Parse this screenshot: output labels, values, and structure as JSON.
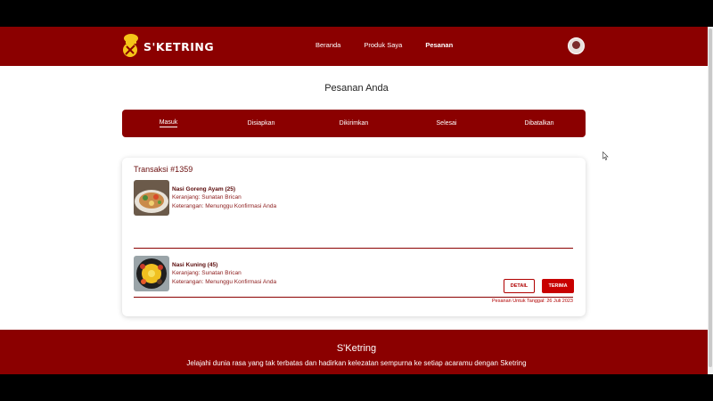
{
  "brand": {
    "name": "S'KETRING"
  },
  "nav": {
    "links": [
      {
        "label": "Beranda"
      },
      {
        "label": "Produk Saya"
      },
      {
        "label": "Pesanan"
      }
    ]
  },
  "page": {
    "title": "Pesanan Anda"
  },
  "tabs": [
    {
      "label": "Masuk"
    },
    {
      "label": "Disiapkan"
    },
    {
      "label": "Dikirimkan"
    },
    {
      "label": "Selesai"
    },
    {
      "label": "Dibatalkan"
    }
  ],
  "order": {
    "title": "Transaksi #1359",
    "items": [
      {
        "name": "Nasi Goreng Ayam (25)",
        "cart": "Keranjang: Sunatan Brican",
        "note": "Keterangan: Menunggu Konfirmasi Anda",
        "image_icon": "fried-rice-icon"
      },
      {
        "name": "Nasi Kuning (45)",
        "cart": "Keranjang: Sunatan Brican",
        "note": "Keterangan: Menunggu Konfirmasi Anda",
        "image_icon": "yellow-rice-icon"
      }
    ],
    "detail_label": "DETAIL",
    "accept_label": "TERIMA",
    "date_note": "Pesanan Untuk Tanggal: 26 Juli 2023"
  },
  "footer": {
    "title": "S'Ketring",
    "description": "Jelajahi dunia rasa yang tak terbatas dan hadirkan kelezatan sempurna ke setiap acaramu dengan Sketring"
  },
  "colors": {
    "primary": "#8b0000",
    "accent": "#c80000"
  }
}
